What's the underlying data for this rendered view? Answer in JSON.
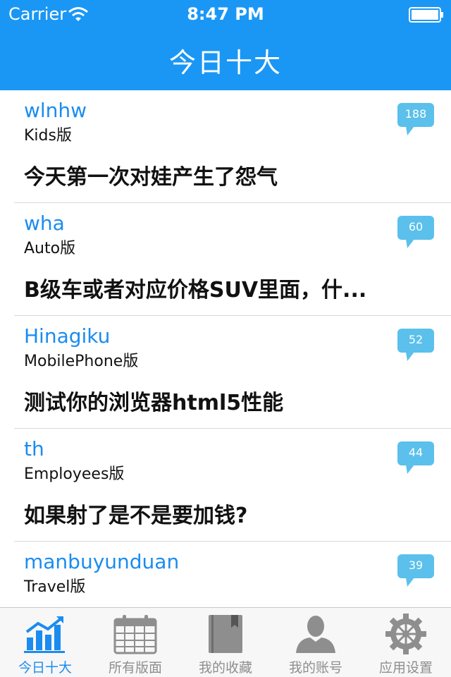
{
  "status_bar": {
    "carrier": "Carrier",
    "time": "8:47 PM"
  },
  "nav": {
    "title": "今日十大"
  },
  "topics": [
    {
      "author": "wlnhw",
      "board": "Kids版",
      "title": "今天第一次对娃产生了怨气",
      "replies": "188"
    },
    {
      "author": "wha",
      "board": "Auto版",
      "title": "B级车或者对应价格SUV里面，什...",
      "replies": "60"
    },
    {
      "author": "Hinagiku",
      "board": "MobilePhone版",
      "title": "测试你的浏览器html5性能",
      "replies": "52"
    },
    {
      "author": "th",
      "board": "Employees版",
      "title": "如果射了是不是要加钱?",
      "replies": "44"
    },
    {
      "author": "manbuyunduan",
      "board": "Travel版",
      "title": "",
      "replies": "39"
    }
  ],
  "tabbar": {
    "tabs": [
      {
        "label": "今日十大",
        "icon": "bar-chart-icon"
      },
      {
        "label": "所有版面",
        "icon": "calendar-icon"
      },
      {
        "label": "我的收藏",
        "icon": "book-icon"
      },
      {
        "label": "我的账号",
        "icon": "person-icon"
      },
      {
        "label": "应用设置",
        "icon": "gear-icon"
      }
    ]
  },
  "colors": {
    "accent": "#1a97f5",
    "link": "#1a8cf0",
    "bubble": "#5bc0eb",
    "tab_inactive": "#8e8e8e"
  }
}
